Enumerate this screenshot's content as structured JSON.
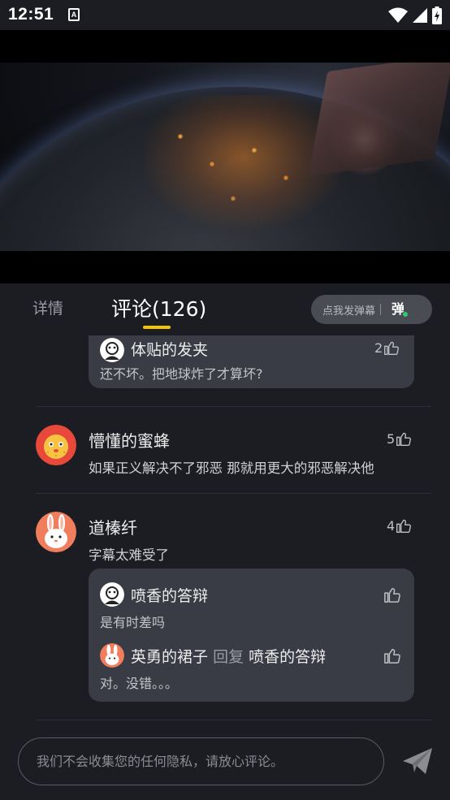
{
  "status_bar": {
    "time": "12:51",
    "app_icon_letter": "A",
    "icons": [
      "wifi-icon",
      "signal-icon",
      "battery-charging-icon"
    ]
  },
  "tabs": {
    "details_label": "详情",
    "comments_label": "评论(126)"
  },
  "danmaku": {
    "button_label": "点我发弹幕",
    "icon_char": "弹"
  },
  "comments": [
    {
      "partial": true,
      "reply_author": "体贴的发夹",
      "reply_text": "还不坏。把地球炸了才算坏?",
      "likes": "2"
    },
    {
      "author": "懵懂的蜜蜂",
      "text": "如果正义解决不了邪恶  那就用更大的邪恶解决他",
      "likes": "5"
    },
    {
      "author": "道榛纤",
      "text": "字幕太难受了",
      "likes": "4",
      "replies": [
        {
          "author": "喷香的答辩",
          "text": "是有时差吗"
        },
        {
          "author": "英勇的裙子",
          "reply_word": "回复",
          "reply_to": "喷香的答辩",
          "text": "对。没错。。。"
        }
      ]
    }
  ],
  "input": {
    "placeholder": "我们不会收集您的任何隐私，请放心评论。"
  },
  "colors": {
    "background": "#1b1d23",
    "reply_box": "#3a3c45",
    "tab_indicator": "#f5c400",
    "danmaku_dot": "#2ecc71"
  }
}
